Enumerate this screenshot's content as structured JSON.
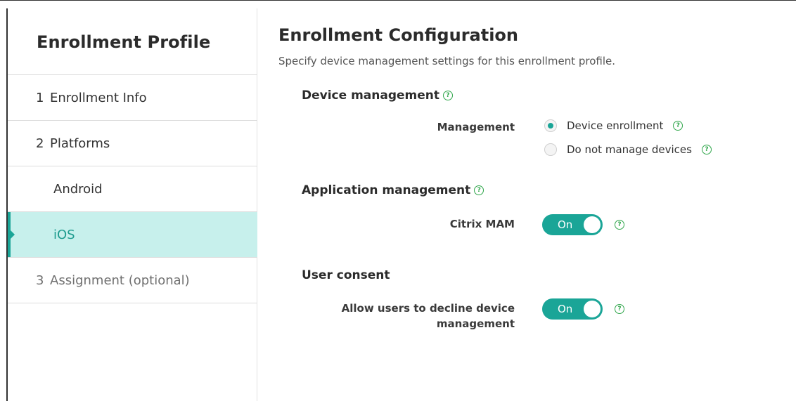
{
  "sidebar": {
    "title": "Enrollment Profile",
    "items": [
      {
        "num": "1",
        "label": "Enrollment Info"
      },
      {
        "num": "2",
        "label": "Platforms"
      },
      {
        "label": "Android"
      },
      {
        "label": "iOS"
      },
      {
        "num": "3",
        "label": "Assignment (optional)"
      }
    ]
  },
  "main": {
    "title": "Enrollment Configuration",
    "subtitle": "Specify device management settings for this enrollment profile.",
    "device_management": {
      "title": "Device management",
      "field_label": "Management",
      "options": [
        {
          "label": "Device enrollment",
          "selected": true
        },
        {
          "label": "Do not manage devices",
          "selected": false
        }
      ]
    },
    "application_management": {
      "title": "Application management",
      "field_label": "Citrix MAM",
      "toggle_label": "On"
    },
    "user_consent": {
      "title": "User consent",
      "field_label_line1": "Allow users to decline device",
      "field_label_line2": "management",
      "toggle_label": "On"
    }
  },
  "icons": {
    "help": "help-circle-icon",
    "glyph": "?"
  },
  "colors": {
    "accent": "#1aa597",
    "active_bg": "#c7f0ec",
    "help": "#2fa64a"
  }
}
